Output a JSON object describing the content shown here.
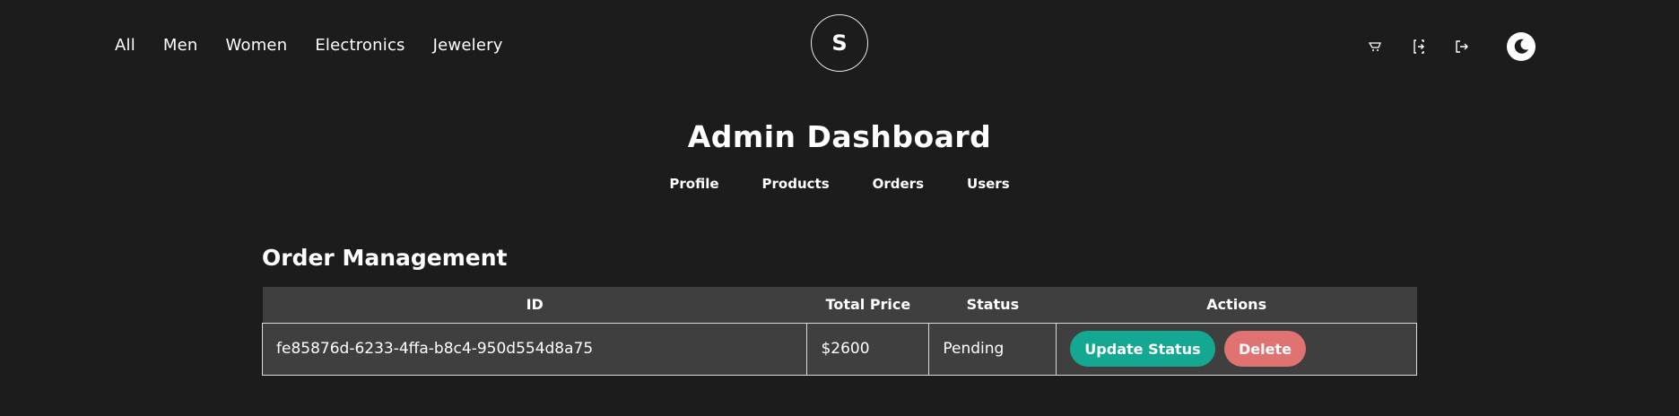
{
  "nav": {
    "categories": [
      "All",
      "Men",
      "Women",
      "Electronics",
      "Jewelery"
    ]
  },
  "logo": {
    "letter": "S"
  },
  "icons": {
    "cart": "cart-icon",
    "login": "login-icon",
    "logout": "logout-icon",
    "theme": "theme-toggle-icon"
  },
  "page": {
    "title": "Admin Dashboard"
  },
  "dashboard_nav": [
    "Profile",
    "Products",
    "Orders",
    "Users"
  ],
  "orders_section": {
    "title": "Order Management",
    "columns": [
      "ID",
      "Total Price",
      "Status",
      "Actions"
    ],
    "rows": [
      {
        "id": "fe85876d-6233-4ffa-b8c4-950d554d8a75",
        "total_price": "$2600",
        "status": "Pending",
        "update_label": "Update Status",
        "delete_label": "Delete"
      }
    ]
  },
  "colors": {
    "background": "#1c1c1c",
    "table_bg": "#3f3f3f",
    "update_button": "#14a893",
    "delete_button": "#e07272"
  }
}
